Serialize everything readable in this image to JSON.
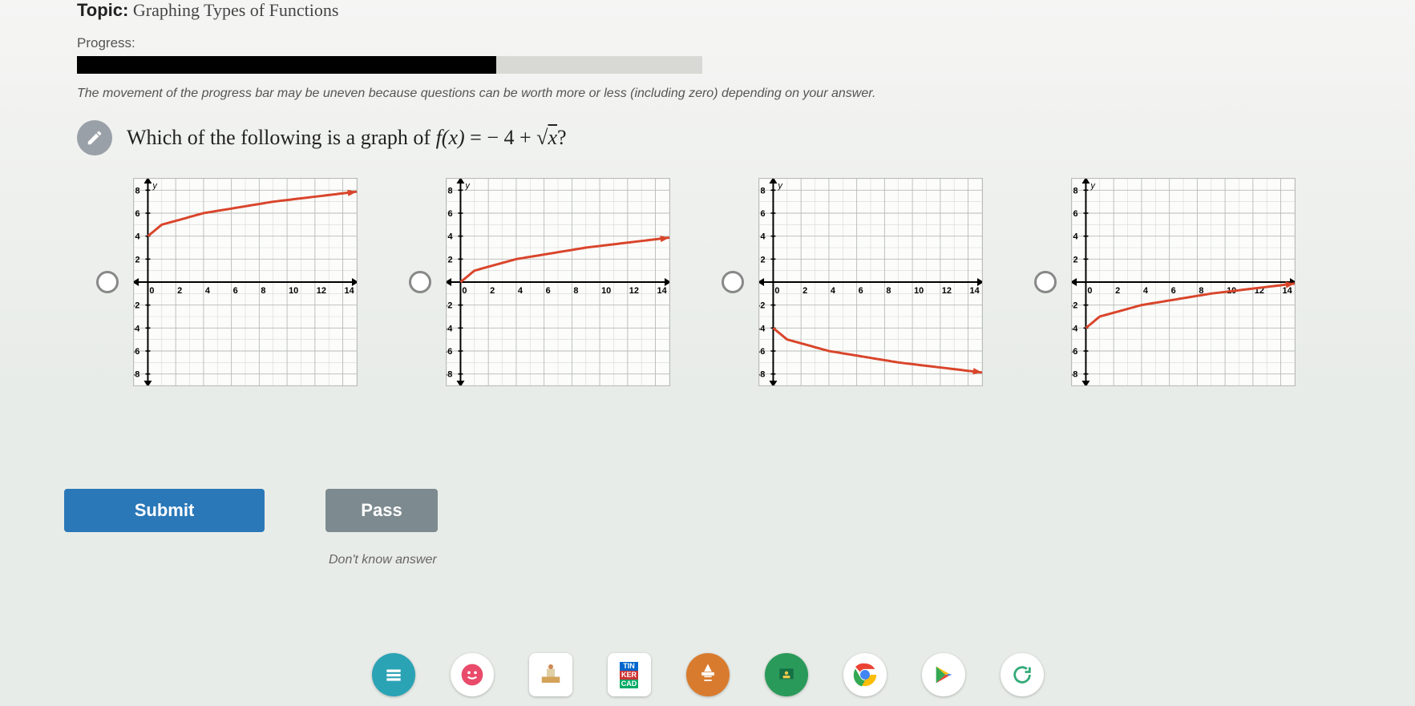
{
  "topic": {
    "label": "Topic:",
    "value": "Graphing Types of Functions"
  },
  "progress": {
    "label": "Progress:",
    "note": "The movement of the progress bar may be uneven because questions can be worth more or less (including zero) depending on your answer.",
    "percent": 67
  },
  "question": {
    "prefix": "Which of the following is a graph of ",
    "eq_lhs": "f(x)",
    "eq_mid": " = − 4 + ",
    "eq_sqrt": "√",
    "eq_radicand": "x",
    "suffix": "?"
  },
  "buttons": {
    "submit": "Submit",
    "pass": "Pass",
    "dont_know": "Don't know answer"
  },
  "axis_ticks_x": [
    "0",
    "2",
    "4",
    "6",
    "8",
    "10",
    "12",
    "14"
  ],
  "axis_ticks_y_pos": [
    "2",
    "4",
    "6",
    "8"
  ],
  "axis_ticks_y_neg": [
    "-2",
    "-4",
    "-6",
    "-8"
  ],
  "chart_data": [
    {
      "type": "line",
      "title": "",
      "xlabel": "",
      "ylabel": "",
      "xlim": [
        -1,
        15
      ],
      "ylim": [
        -9,
        9
      ],
      "description": "y = 4 + sqrt(x)",
      "series": [
        {
          "name": "curve",
          "points": [
            [
              0,
              4
            ],
            [
              1,
              5
            ],
            [
              4,
              6
            ],
            [
              9,
              7
            ],
            [
              15,
              7.87
            ]
          ]
        }
      ]
    },
    {
      "type": "line",
      "title": "",
      "xlabel": "",
      "ylabel": "",
      "xlim": [
        -1,
        15
      ],
      "ylim": [
        -9,
        9
      ],
      "description": "y = sqrt(x)",
      "series": [
        {
          "name": "curve",
          "points": [
            [
              0,
              0
            ],
            [
              1,
              1
            ],
            [
              4,
              2
            ],
            [
              9,
              3
            ],
            [
              15,
              3.87
            ]
          ]
        }
      ]
    },
    {
      "type": "line",
      "title": "",
      "xlabel": "",
      "ylabel": "",
      "xlim": [
        -1,
        15
      ],
      "ylim": [
        -9,
        9
      ],
      "description": "y = -4 - sqrt(x)",
      "series": [
        {
          "name": "curve",
          "points": [
            [
              0,
              -4
            ],
            [
              1,
              -5
            ],
            [
              4,
              -6
            ],
            [
              9,
              -7
            ],
            [
              15,
              -7.87
            ]
          ]
        }
      ]
    },
    {
      "type": "line",
      "title": "",
      "xlabel": "",
      "ylabel": "",
      "xlim": [
        -1,
        15
      ],
      "ylim": [
        -9,
        9
      ],
      "description": "y = -4 + sqrt(x)",
      "series": [
        {
          "name": "curve",
          "points": [
            [
              0,
              -4
            ],
            [
              1,
              -3
            ],
            [
              4,
              -2
            ],
            [
              9,
              -1
            ],
            [
              15,
              -0.13
            ]
          ]
        }
      ]
    }
  ],
  "taskbar": {
    "items": [
      "files-icon",
      "messages-icon",
      "builder-icon",
      "tinkercad-icon",
      "knowledge-icon",
      "classroom-icon",
      "chrome-icon",
      "play-store-icon",
      "sync-icon"
    ]
  }
}
